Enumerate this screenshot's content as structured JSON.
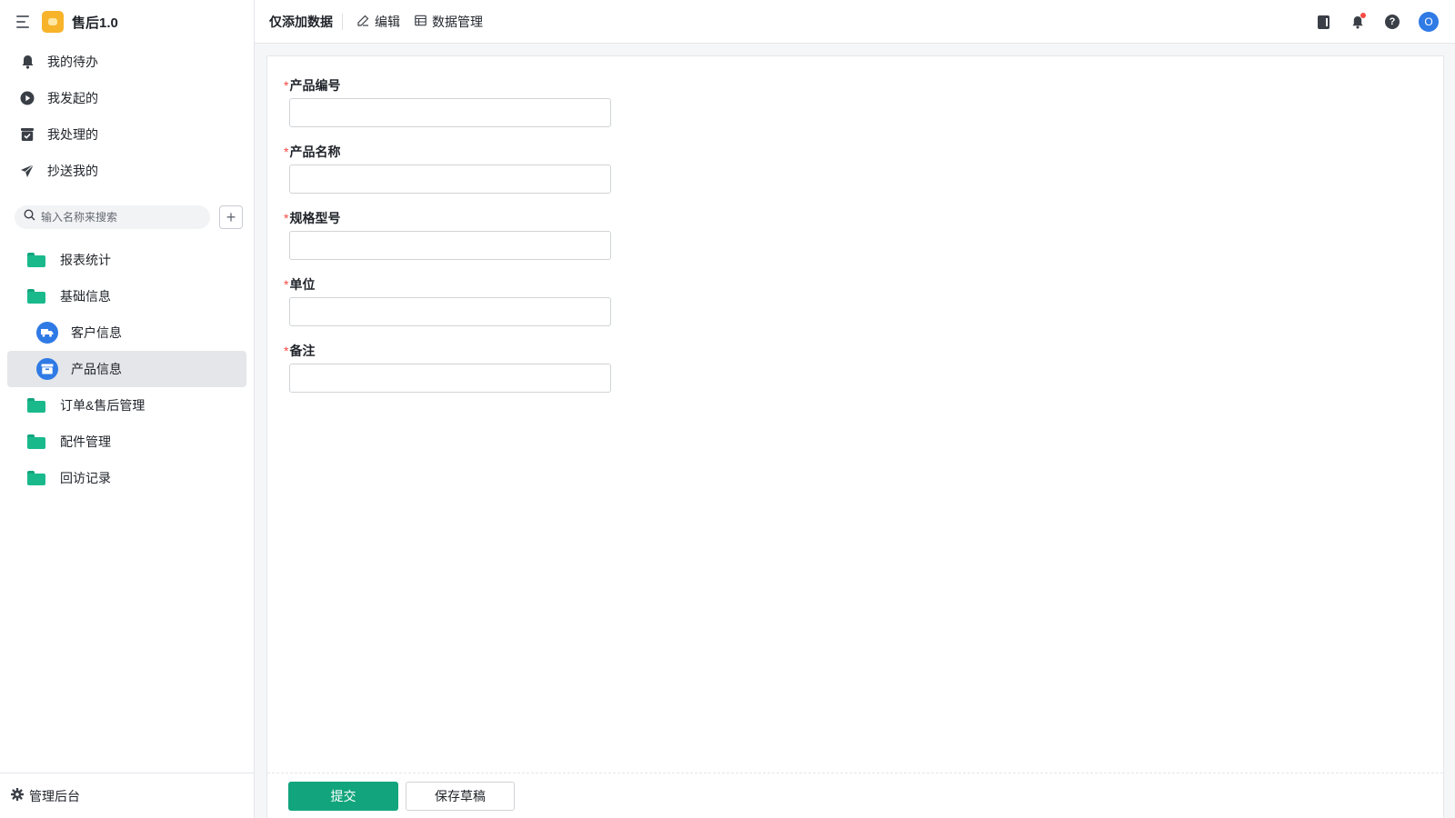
{
  "app": {
    "name": "售后1.0",
    "logo_icon": "app-logo-icon",
    "brand_color": "#f7b329"
  },
  "sidebar": {
    "nav": [
      {
        "label": "我的待办",
        "icon": "bell-icon"
      },
      {
        "label": "我发起的",
        "icon": "play-circle-icon"
      },
      {
        "label": "我处理的",
        "icon": "check-box-icon"
      },
      {
        "label": "抄送我的",
        "icon": "send-icon"
      }
    ],
    "search": {
      "placeholder": "输入名称来搜索",
      "value": ""
    },
    "add_label": "+",
    "tree": [
      {
        "label": "报表统计",
        "icon": "folder-icon"
      },
      {
        "label": "基础信息",
        "icon": "folder-open-icon"
      },
      {
        "label": "客户信息",
        "icon": "truck-icon"
      },
      {
        "label": "产品信息",
        "icon": "box-icon",
        "active": true
      },
      {
        "label": "订单&售后管理",
        "icon": "folder-icon"
      },
      {
        "label": "配件管理",
        "icon": "folder-icon"
      },
      {
        "label": "回访记录",
        "icon": "folder-icon"
      }
    ],
    "footer_label": "管理后台"
  },
  "topbar": {
    "title": "仅添加数据",
    "edit_label": "编辑",
    "data_manage_label": "数据管理",
    "avatar_letter": "O"
  },
  "form": {
    "required_mark": "*",
    "fields": [
      {
        "label": "产品编号",
        "value": ""
      },
      {
        "label": "产品名称",
        "value": ""
      },
      {
        "label": "规格型号",
        "value": ""
      },
      {
        "label": "单位",
        "value": ""
      },
      {
        "label": "备注",
        "value": ""
      }
    ],
    "submit_label": "提交",
    "draft_label": "保存草稿"
  },
  "colors": {
    "accent": "#12a57d",
    "primary_blue": "#2f7ae5",
    "required": "#f54a45"
  }
}
